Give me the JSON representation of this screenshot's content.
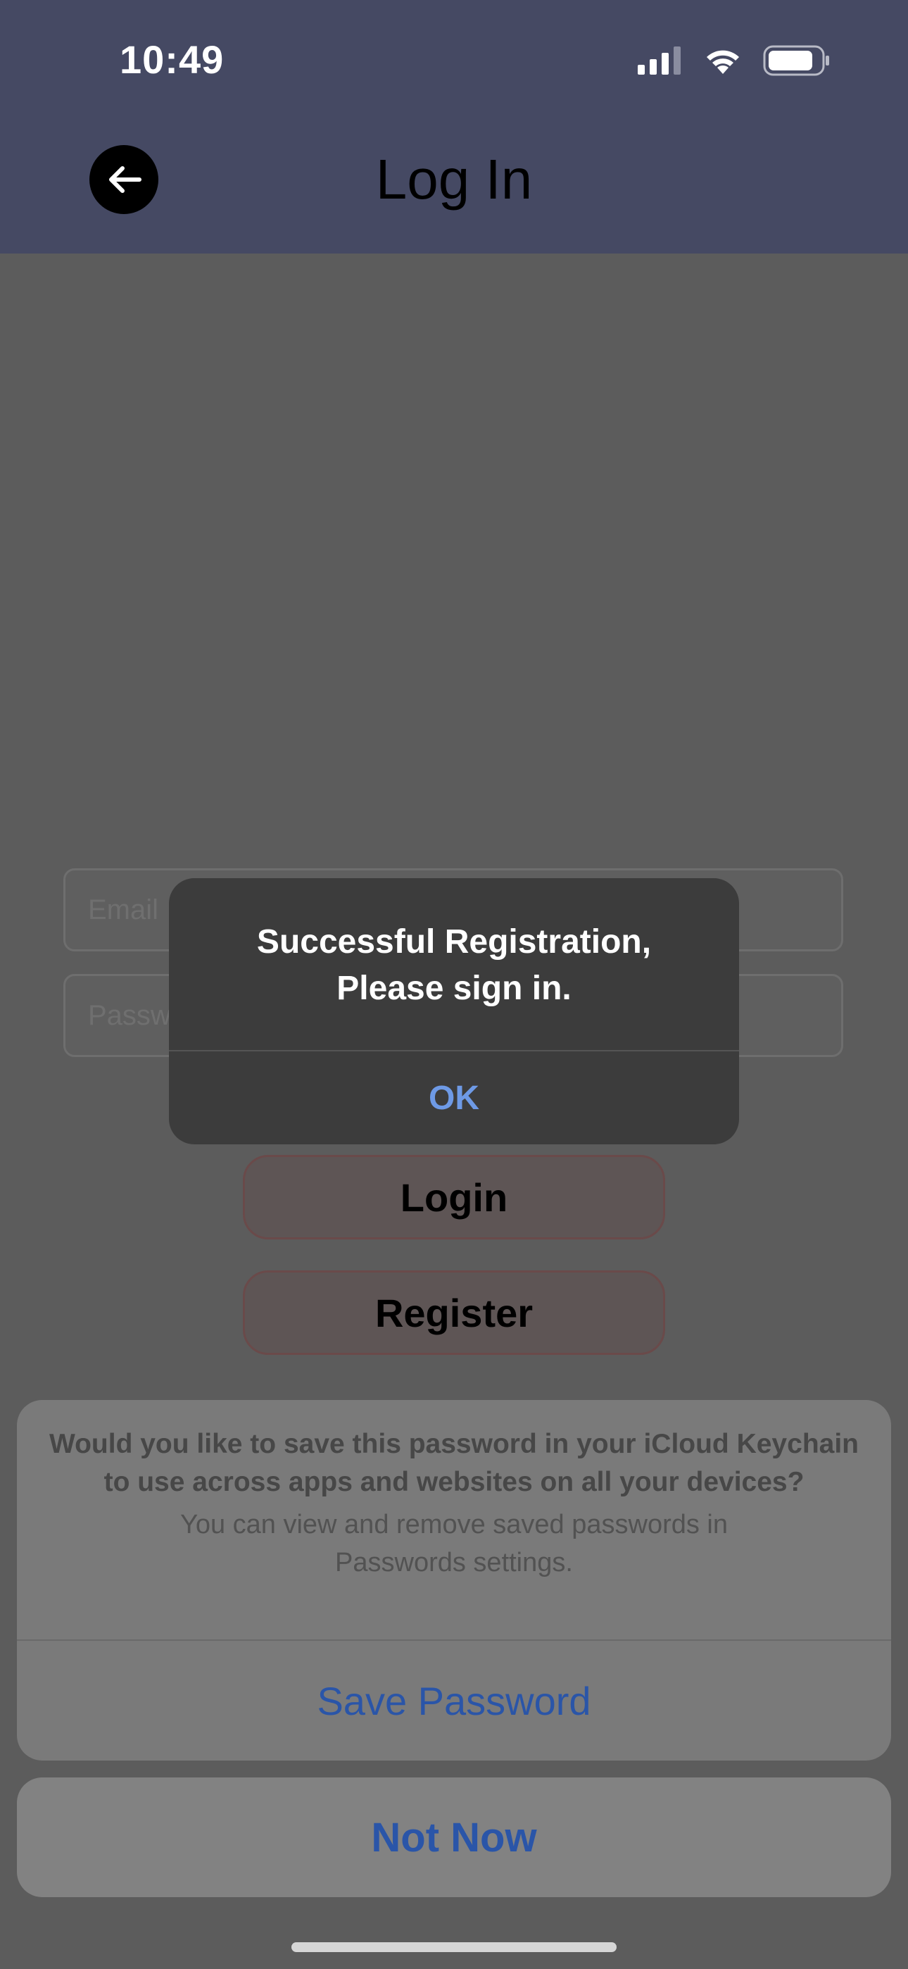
{
  "status_bar": {
    "time": "10:49",
    "icons": [
      "cellular-signal-icon",
      "wifi-icon",
      "battery-icon"
    ]
  },
  "nav": {
    "title": "Log In",
    "back_icon": "arrow-left-icon"
  },
  "form": {
    "email_placeholder": "Email",
    "password_placeholder": "Password",
    "login_label": "Login",
    "register_label": "Register"
  },
  "alert": {
    "message": "Successful Registration,\nPlease sign in.",
    "ok_label": "OK"
  },
  "keychain_sheet": {
    "title": "Would you like to save this password in your iCloud Keychain\nto use across apps and websites on all your devices?",
    "subtitle": "You can view and remove saved passwords in\nPasswords settings.",
    "save_label": "Save Password",
    "not_now_label": "Not Now"
  },
  "colors": {
    "header_bg": "#454963",
    "overlay_bg": "#5c5c5c",
    "alert_bg": "#3c3c3c",
    "alert_ok": "#6e9ae6",
    "sheet_action": "#2a55a8"
  }
}
